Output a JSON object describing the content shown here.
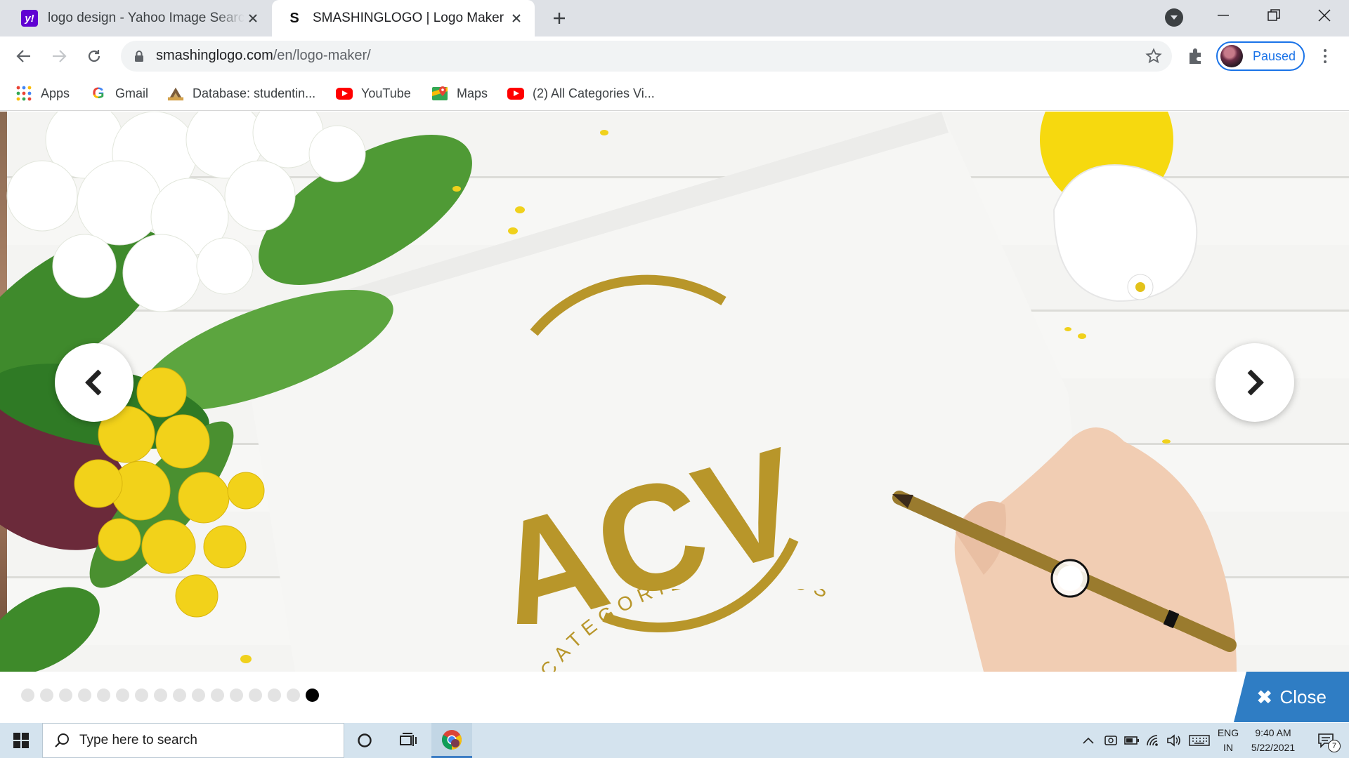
{
  "browser": {
    "tabs": [
      {
        "title": "logo design - Yahoo Image Search",
        "favicon": "yahoo-icon"
      },
      {
        "title": "SMASHINGLOGO | Logo Maker",
        "favicon": "smashinglogo-icon",
        "active": true
      }
    ],
    "url_host": "smashinglogo.com",
    "url_path": "/en/logo-maker/",
    "profile_label": "Paused",
    "accent": "#1a73e8"
  },
  "bookmarks": [
    {
      "label": "Apps",
      "icon": "apps-grid-icon"
    },
    {
      "label": "Gmail",
      "icon": "google-g-icon"
    },
    {
      "label": "Database: studentin...",
      "icon": "database-icon"
    },
    {
      "label": "YouTube",
      "icon": "youtube-icon"
    },
    {
      "label": "Maps",
      "icon": "maps-icon"
    },
    {
      "label": "(2) All Categories Vi...",
      "icon": "youtube-icon"
    }
  ],
  "slide": {
    "logo_letters": "ACV",
    "logo_tagline": "ALL CATEGORIES VIDEOS",
    "logo_color": "#b8962a",
    "dot_count": 16,
    "active_dot": 16
  },
  "close_label": "Close",
  "close_color": "#2f7dc4",
  "taskbar": {
    "search_placeholder": "Type here to search",
    "lang_top": "ENG",
    "lang_bottom": "IN",
    "time": "9:40 AM",
    "date": "5/22/2021",
    "notification_count": "7"
  }
}
